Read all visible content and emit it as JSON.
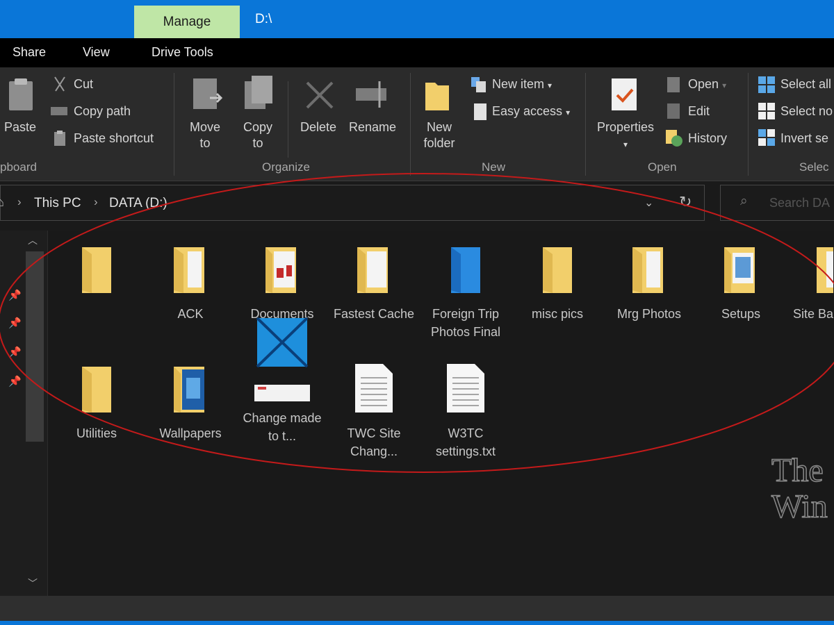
{
  "window": {
    "context_tab": "Manage",
    "path": "D:\\"
  },
  "tabs": [
    "Share",
    "View",
    "Drive Tools"
  ],
  "ribbon": {
    "clipboard": {
      "paste": "Paste",
      "cut": "Cut",
      "copy_path": "Copy path",
      "paste_shortcut": "Paste shortcut",
      "label": "pboard"
    },
    "organize": {
      "move_to_1": "Move",
      "move_to_2": "to",
      "copy_to_1": "Copy",
      "copy_to_2": "to",
      "delete": "Delete",
      "rename": "Rename",
      "label": "Organize"
    },
    "new": {
      "new_folder_1": "New",
      "new_folder_2": "folder",
      "new_item": "New item",
      "easy_access": "Easy access",
      "label": "New"
    },
    "open": {
      "properties": "Properties",
      "open": "Open",
      "edit": "Edit",
      "history": "History",
      "label": "Open"
    },
    "select": {
      "select_all": "Select all",
      "select_none": "Select no",
      "invert": "Invert se",
      "label": "Selec"
    }
  },
  "address": {
    "crumbs": [
      "This PC",
      "DATA (D:)"
    ],
    "search_placeholder": "Search DA"
  },
  "items": [
    {
      "name": "",
      "kind": "folder"
    },
    {
      "name": "ACK",
      "kind": "folder-docs"
    },
    {
      "name": "Documents",
      "kind": "folder-red"
    },
    {
      "name": "Fastest Cache",
      "kind": "folder-docs"
    },
    {
      "name": "Foreign Trip Photos Final",
      "kind": "folder-blue"
    },
    {
      "name": "misc pics",
      "kind": "folder"
    },
    {
      "name": "Mrg Photos",
      "kind": "folder-docs"
    },
    {
      "name": "Setups",
      "kind": "folder-photo"
    },
    {
      "name": "Site Ba",
      "kind": "folder-docs"
    },
    {
      "name": "Utilities",
      "kind": "folder"
    },
    {
      "name": "Wallpapers",
      "kind": "folder-blue-img"
    },
    {
      "name": "Change made to t...",
      "kind": "image"
    },
    {
      "name": "TWC Site Chang...",
      "kind": "text"
    },
    {
      "name": "W3TC settings.txt",
      "kind": "text"
    }
  ],
  "watermark": [
    "The",
    "Win"
  ],
  "colors": {
    "titlebar": "#0a76d8",
    "manage_tab": "#bfe6a6",
    "folder": "#f2cf6b",
    "annotation": "#c41a1a"
  }
}
